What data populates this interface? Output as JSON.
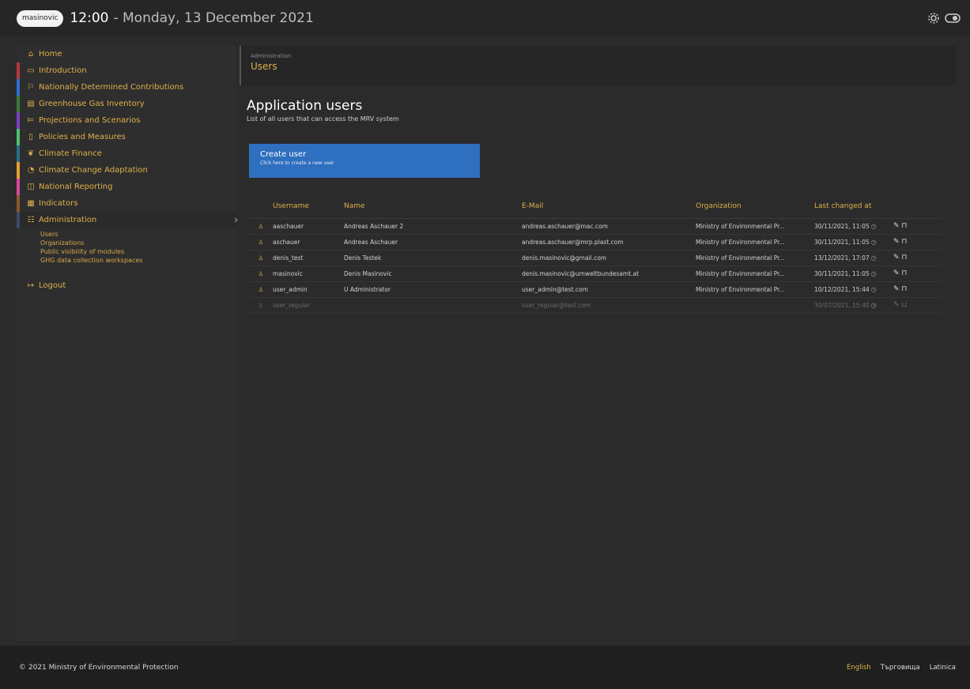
{
  "header": {
    "logo": "masinovic",
    "time": "12:00",
    "date": "- Monday, 13 December 2021"
  },
  "sidebar": {
    "items": [
      {
        "label": "Home",
        "icon": "home-icon",
        "color": "#e0b04a"
      },
      {
        "label": "Introduction",
        "icon": "book-icon",
        "color": "#b33a3a"
      },
      {
        "label": "Nationally Determined Contributions",
        "icon": "flag-icon",
        "color": "#2f6fd4"
      },
      {
        "label": "Greenhouse Gas Inventory",
        "icon": "table-icon",
        "color": "#3a7a3a"
      },
      {
        "label": "Projections and Scenarios",
        "icon": "chart-icon",
        "color": "#7d3fc4"
      },
      {
        "label": "Policies and Measures",
        "icon": "document-icon",
        "color": "#4fbf6f"
      },
      {
        "label": "Climate Finance",
        "icon": "leaf-icon",
        "color": "#2a6f8a"
      },
      {
        "label": "Climate Change Adaptation",
        "icon": "adapt-icon",
        "color": "#e8a030"
      },
      {
        "label": "National Reporting",
        "icon": "report-icon",
        "color": "#d84aa0"
      },
      {
        "label": "Indicators",
        "icon": "indicator-icon",
        "color": "#8a5a2a"
      },
      {
        "label": "Administration",
        "icon": "admin-icon",
        "color": "#3a4a6a"
      }
    ],
    "admin_sub": [
      "Users",
      "Organizations",
      "Public visibility of modules",
      "GHG data collection workspaces"
    ],
    "logout": "Logout"
  },
  "breadcrumb": {
    "section": "Administration",
    "page": "Users"
  },
  "main": {
    "title": "Application users",
    "subtitle": "List of all users that can access the MRV system",
    "create_label": "Create user",
    "create_hint": "Click here to create a new user"
  },
  "table": {
    "columns": [
      "Username",
      "Name",
      "E-Mail",
      "Organization",
      "Last changed at"
    ],
    "rows": [
      {
        "username": "aaschauer",
        "name": "Andreas Aschauer 2",
        "email": "andreas.aschauer@mac.com",
        "org": "Ministry of Environmental Pr...",
        "changed": "30/11/2021, 11:05",
        "dim": false
      },
      {
        "username": "aschauer",
        "name": "Andreas Aschauer",
        "email": "andreas.aschauer@mrp.plast.com",
        "org": "Ministry of Environmental Pr...",
        "changed": "30/11/2021, 11:05",
        "dim": false
      },
      {
        "username": "denis_test",
        "name": "Denis Testek",
        "email": "denis.masinovic@gmail.com",
        "org": "Ministry of Environmental Pr...",
        "changed": "13/12/2021, 17:07",
        "dim": false
      },
      {
        "username": "masinovic",
        "name": "Denis Masinovic",
        "email": "denis.masinovic@umweltbundesamt.at",
        "org": "Ministry of Environmental Pr...",
        "changed": "30/11/2021, 11:05",
        "dim": false
      },
      {
        "username": "user_admin",
        "name": "U Administrator",
        "email": "user_admin@test.com",
        "org": "Ministry of Environmental Pr...",
        "changed": "10/12/2021, 15:44",
        "dim": false
      },
      {
        "username": "user_regular",
        "name": "",
        "email": "user_regular@test.com",
        "org": "",
        "changed": "30/07/2021, 15:40",
        "dim": true
      }
    ]
  },
  "footer": {
    "copyright": "© 2021 Ministry of Environmental Protection",
    "languages": [
      "English",
      "Търговища",
      "Latinica"
    ]
  }
}
